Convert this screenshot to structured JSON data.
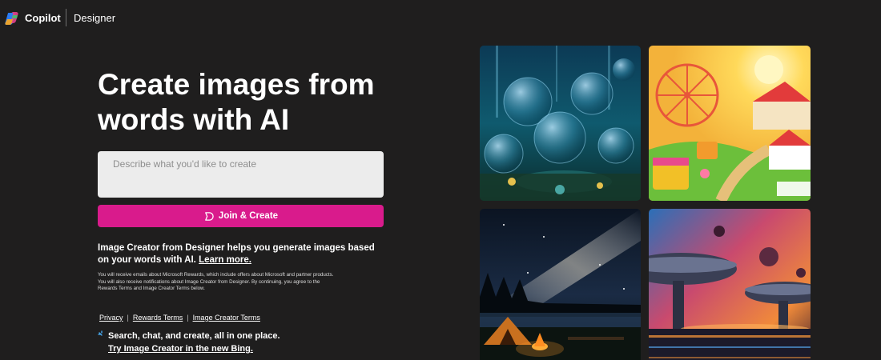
{
  "header": {
    "brand": "Copilot",
    "product": "Designer",
    "logo_icon": "copilot-logo-icon"
  },
  "hero": {
    "title": "Create images from words with AI"
  },
  "prompt": {
    "placeholder": "Describe what you'd like to create",
    "value": ""
  },
  "join_button": {
    "label": "Join & Create",
    "icon": "rewards-icon",
    "color": "#d91b8c"
  },
  "description": {
    "text": "Image Creator from Designer helps you generate images based on your words with AI.",
    "learn_more": "Learn more."
  },
  "fine_print": "You will receive emails about Microsoft Rewards, which include offers about Microsoft and partner products. You will also receive notifications about Image Creator from Designer. By continuing, you agree to the Rewards Terms and Image Creator Terms below.",
  "legal_links": {
    "privacy": "Privacy",
    "separator": "|",
    "rewards_terms": "Rewards Terms",
    "image_creator_terms": "Image Creator Terms"
  },
  "promo": {
    "icon": "sparkle-icon",
    "text": "Search, chat, and create, all in one place.",
    "link": "Try Image Creator in the new Bing."
  },
  "gallery": {
    "tiles": [
      {
        "scene": "underwater-bubble-city-image"
      },
      {
        "scene": "carnival-fairground-image"
      },
      {
        "scene": "milky-way-campfire-image"
      },
      {
        "scene": "alien-space-city-image"
      }
    ]
  },
  "colors": {
    "background": "#1f1e1e",
    "accent": "#d91b8c",
    "input_bg": "#ececec"
  }
}
